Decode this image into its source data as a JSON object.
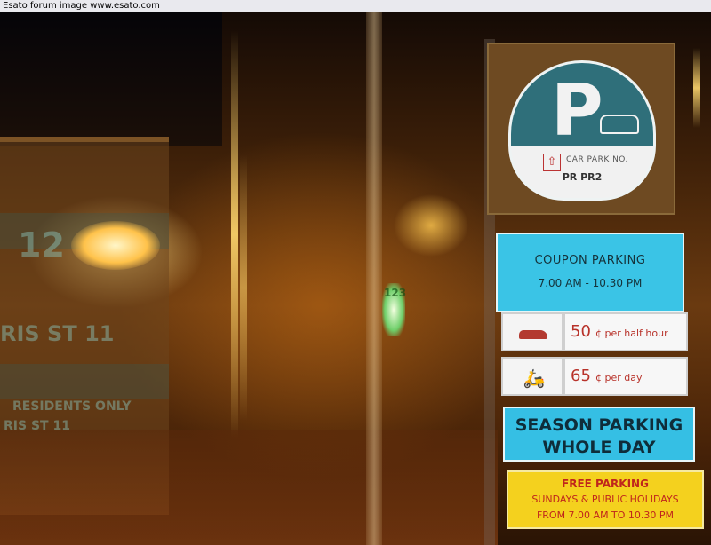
{
  "banner": {
    "text": "Esato forum image www.esato.com"
  },
  "background_text": {
    "street_sign_top": "12",
    "street_sign_mid": "RIS ST 11",
    "street_sign_low": "RESIDENTS ONLY",
    "street_sign_low2": "RIS ST 11",
    "green_sign": "123"
  },
  "parking_sign": {
    "letter": "P",
    "car_park_label": "CAR PARK NO.",
    "car_park_number": "PR  PR2"
  },
  "coupon_panel": {
    "title": "COUPON PARKING",
    "hours": "7.00 AM - 10.30 PM"
  },
  "rates": [
    {
      "vehicle_icon": "car-icon",
      "amount": "50",
      "unit": "¢ per half hour"
    },
    {
      "vehicle_icon": "motorcycle-icon",
      "amount": "65",
      "unit": "¢ per day"
    }
  ],
  "season_panel": {
    "line1": "SEASON PARKING",
    "line2": "WHOLE DAY"
  },
  "free_panel": {
    "line1": "FREE PARKING",
    "line2": "SUNDAYS & PUBLIC HOLIDAYS",
    "line3": "FROM  7.00 AM TO 10.30 PM"
  },
  "colors": {
    "coupon_blue": "#3ac4e6",
    "season_blue": "#35bfe4",
    "free_yellow": "#f4d11e",
    "rate_red": "#b8322a",
    "p_sign_teal": "#2f6f7a"
  }
}
